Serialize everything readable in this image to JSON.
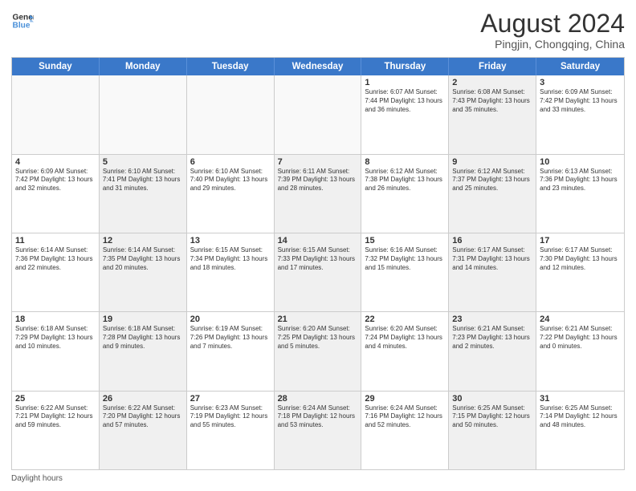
{
  "header": {
    "logo_line1": "General",
    "logo_line2": "Blue",
    "title": "August 2024",
    "subtitle": "Pingjin, Chongqing, China"
  },
  "calendar": {
    "days_of_week": [
      "Sunday",
      "Monday",
      "Tuesday",
      "Wednesday",
      "Thursday",
      "Friday",
      "Saturday"
    ],
    "weeks": [
      [
        {
          "day": "",
          "info": "",
          "empty": true
        },
        {
          "day": "",
          "info": "",
          "empty": true
        },
        {
          "day": "",
          "info": "",
          "empty": true
        },
        {
          "day": "",
          "info": "",
          "empty": true
        },
        {
          "day": "1",
          "info": "Sunrise: 6:07 AM\nSunset: 7:44 PM\nDaylight: 13 hours\nand 36 minutes."
        },
        {
          "day": "2",
          "info": "Sunrise: 6:08 AM\nSunset: 7:43 PM\nDaylight: 13 hours\nand 35 minutes.",
          "alt": true
        },
        {
          "day": "3",
          "info": "Sunrise: 6:09 AM\nSunset: 7:42 PM\nDaylight: 13 hours\nand 33 minutes."
        }
      ],
      [
        {
          "day": "4",
          "info": "Sunrise: 6:09 AM\nSunset: 7:42 PM\nDaylight: 13 hours\nand 32 minutes."
        },
        {
          "day": "5",
          "info": "Sunrise: 6:10 AM\nSunset: 7:41 PM\nDaylight: 13 hours\nand 31 minutes.",
          "alt": true
        },
        {
          "day": "6",
          "info": "Sunrise: 6:10 AM\nSunset: 7:40 PM\nDaylight: 13 hours\nand 29 minutes."
        },
        {
          "day": "7",
          "info": "Sunrise: 6:11 AM\nSunset: 7:39 PM\nDaylight: 13 hours\nand 28 minutes.",
          "alt": true
        },
        {
          "day": "8",
          "info": "Sunrise: 6:12 AM\nSunset: 7:38 PM\nDaylight: 13 hours\nand 26 minutes."
        },
        {
          "day": "9",
          "info": "Sunrise: 6:12 AM\nSunset: 7:37 PM\nDaylight: 13 hours\nand 25 minutes.",
          "alt": true
        },
        {
          "day": "10",
          "info": "Sunrise: 6:13 AM\nSunset: 7:36 PM\nDaylight: 13 hours\nand 23 minutes."
        }
      ],
      [
        {
          "day": "11",
          "info": "Sunrise: 6:14 AM\nSunset: 7:36 PM\nDaylight: 13 hours\nand 22 minutes."
        },
        {
          "day": "12",
          "info": "Sunrise: 6:14 AM\nSunset: 7:35 PM\nDaylight: 13 hours\nand 20 minutes.",
          "alt": true
        },
        {
          "day": "13",
          "info": "Sunrise: 6:15 AM\nSunset: 7:34 PM\nDaylight: 13 hours\nand 18 minutes."
        },
        {
          "day": "14",
          "info": "Sunrise: 6:15 AM\nSunset: 7:33 PM\nDaylight: 13 hours\nand 17 minutes.",
          "alt": true
        },
        {
          "day": "15",
          "info": "Sunrise: 6:16 AM\nSunset: 7:32 PM\nDaylight: 13 hours\nand 15 minutes."
        },
        {
          "day": "16",
          "info": "Sunrise: 6:17 AM\nSunset: 7:31 PM\nDaylight: 13 hours\nand 14 minutes.",
          "alt": true
        },
        {
          "day": "17",
          "info": "Sunrise: 6:17 AM\nSunset: 7:30 PM\nDaylight: 13 hours\nand 12 minutes."
        }
      ],
      [
        {
          "day": "18",
          "info": "Sunrise: 6:18 AM\nSunset: 7:29 PM\nDaylight: 13 hours\nand 10 minutes."
        },
        {
          "day": "19",
          "info": "Sunrise: 6:18 AM\nSunset: 7:28 PM\nDaylight: 13 hours\nand 9 minutes.",
          "alt": true
        },
        {
          "day": "20",
          "info": "Sunrise: 6:19 AM\nSunset: 7:26 PM\nDaylight: 13 hours\nand 7 minutes."
        },
        {
          "day": "21",
          "info": "Sunrise: 6:20 AM\nSunset: 7:25 PM\nDaylight: 13 hours\nand 5 minutes.",
          "alt": true
        },
        {
          "day": "22",
          "info": "Sunrise: 6:20 AM\nSunset: 7:24 PM\nDaylight: 13 hours\nand 4 minutes."
        },
        {
          "day": "23",
          "info": "Sunrise: 6:21 AM\nSunset: 7:23 PM\nDaylight: 13 hours\nand 2 minutes.",
          "alt": true
        },
        {
          "day": "24",
          "info": "Sunrise: 6:21 AM\nSunset: 7:22 PM\nDaylight: 13 hours\nand 0 minutes."
        }
      ],
      [
        {
          "day": "25",
          "info": "Sunrise: 6:22 AM\nSunset: 7:21 PM\nDaylight: 12 hours\nand 59 minutes."
        },
        {
          "day": "26",
          "info": "Sunrise: 6:22 AM\nSunset: 7:20 PM\nDaylight: 12 hours\nand 57 minutes.",
          "alt": true
        },
        {
          "day": "27",
          "info": "Sunrise: 6:23 AM\nSunset: 7:19 PM\nDaylight: 12 hours\nand 55 minutes."
        },
        {
          "day": "28",
          "info": "Sunrise: 6:24 AM\nSunset: 7:18 PM\nDaylight: 12 hours\nand 53 minutes.",
          "alt": true
        },
        {
          "day": "29",
          "info": "Sunrise: 6:24 AM\nSunset: 7:16 PM\nDaylight: 12 hours\nand 52 minutes."
        },
        {
          "day": "30",
          "info": "Sunrise: 6:25 AM\nSunset: 7:15 PM\nDaylight: 12 hours\nand 50 minutes.",
          "alt": true
        },
        {
          "day": "31",
          "info": "Sunrise: 6:25 AM\nSunset: 7:14 PM\nDaylight: 12 hours\nand 48 minutes."
        }
      ]
    ]
  },
  "footer": {
    "label": "Daylight hours"
  }
}
